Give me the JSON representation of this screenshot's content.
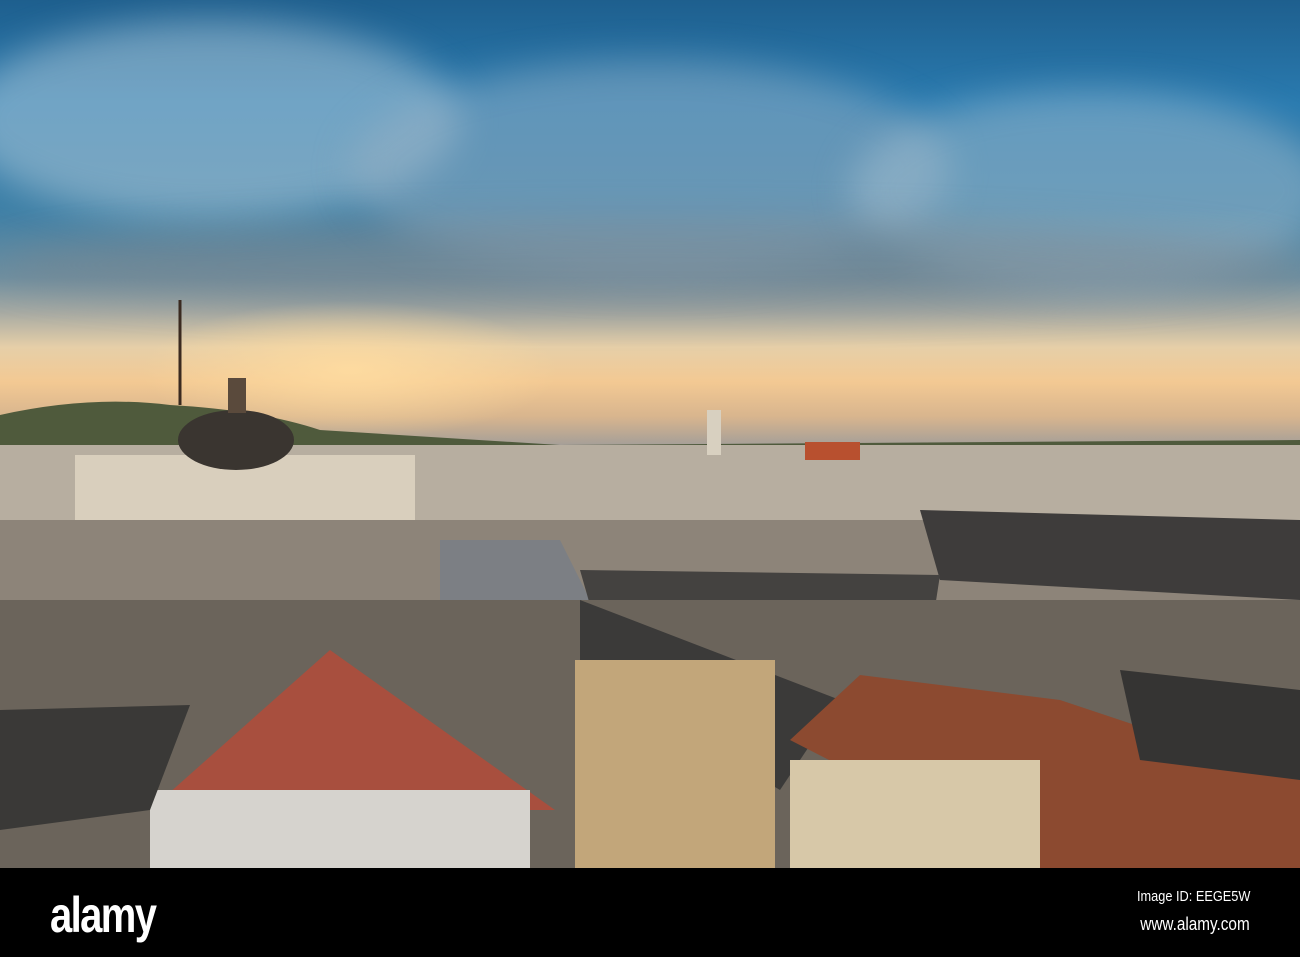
{
  "photo": {
    "subject": "city rooftops at sunset",
    "colors": {
      "sky_top": "#1e5f8e",
      "horizon": "#f3c993",
      "roofs": "#4a4845",
      "rust": "#9a4a30"
    }
  },
  "watermark": {
    "logo": "alamy",
    "image_id": "Image ID: EEGE5W",
    "site": "www.alamy.com"
  }
}
